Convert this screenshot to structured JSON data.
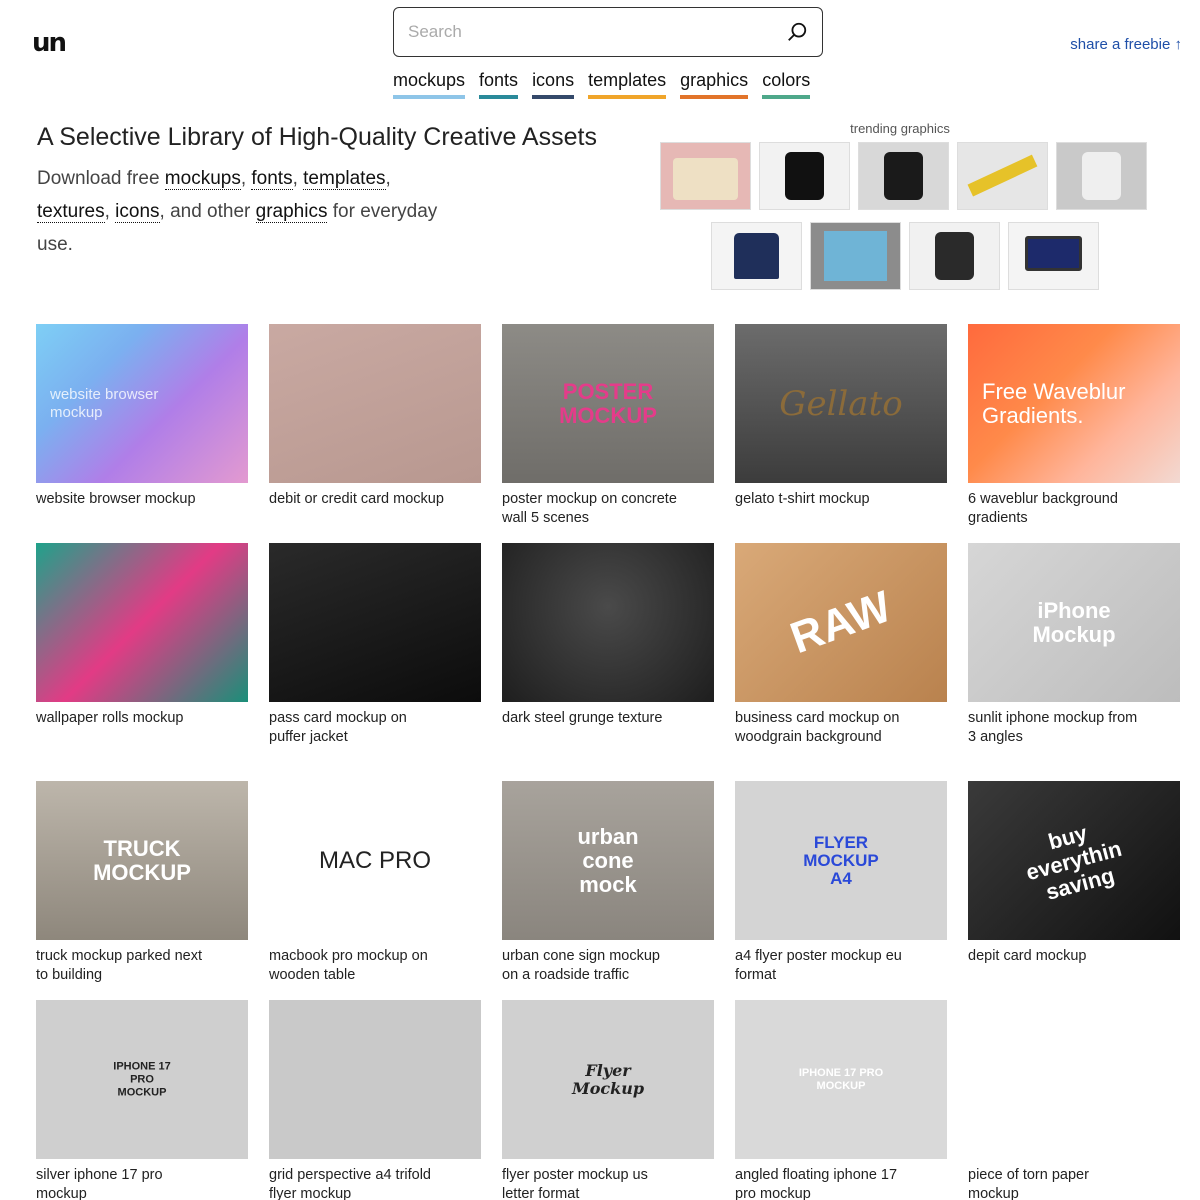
{
  "logo": "un",
  "search": {
    "placeholder": "Search"
  },
  "share": "share a freebie ↑",
  "nav": [
    {
      "label": "mockups",
      "color": "#8ec5e8"
    },
    {
      "label": "fonts",
      "color": "#2a8a9a"
    },
    {
      "label": "icons",
      "color": "#34496a"
    },
    {
      "label": "templates",
      "color": "#f0a52a"
    },
    {
      "label": "graphics",
      "color": "#e2742a"
    },
    {
      "label": "colors",
      "color": "#4ea88a"
    }
  ],
  "hero": {
    "title": "A Selective Library of High-Quality Creative Assets",
    "intro": "Download free ",
    "links": [
      "mockups",
      "fonts",
      "templates",
      "textures",
      "icons",
      "graphics"
    ],
    "sep": ", ",
    "and_other": ", and other ",
    "outro": " for everyday use."
  },
  "trending": {
    "label": "trending graphics",
    "items": [
      {
        "name": "tshirts",
        "bg": "#e6b8b5",
        "fg": "#eee0c4"
      },
      {
        "name": "iphone-dark",
        "bg": "#f2f2f2",
        "fg": "#111"
      },
      {
        "name": "iphone-apps",
        "bg": "#d8d8d8",
        "fg": "#1a1a1a"
      },
      {
        "name": "lanyard",
        "bg": "#e6e6e6",
        "fg": "#e6c229"
      },
      {
        "name": "iphone-silver",
        "bg": "#c9c9c9",
        "fg": "#efefef"
      },
      {
        "name": "polo",
        "bg": "#f4f4f4",
        "fg": "#1f2f5a"
      },
      {
        "name": "poster",
        "bg": "#8c8c8c",
        "fg": "#6fb4d6"
      },
      {
        "name": "iphone-gold",
        "bg": "#f1f1f1",
        "fg": "#2a2a2a"
      },
      {
        "name": "macbook",
        "bg": "#f4f4f4",
        "fg": "#1d2a6b"
      }
    ]
  },
  "cards": [
    {
      "title": "website browser mockup",
      "bg": "linear-gradient(135deg,#7ecff5 0%,#7bb0f0 30%,#b07ee8 60%,#e39ad0 100%)",
      "overlay": "website browser\nmockup",
      "ovColor": "#ffffff"
    },
    {
      "title": "debit or credit card mockup",
      "bg": "linear-gradient(160deg,#c9a9a2,#b89890)",
      "overlay": "",
      "ovColor": "#fff"
    },
    {
      "title": "poster mockup on concrete wall 5 scenes",
      "bg": "linear-gradient(180deg,#8d8b86,#6f6d69)",
      "overlay": "POSTER\nMOCKUP",
      "ovColor": "#e43c8a"
    },
    {
      "title": "gelato t-shirt mockup",
      "bg": "linear-gradient(180deg,#6c6c6c,#3c3c3c)",
      "overlay": "Gellato",
      "ovColor": "#8b6b3a"
    },
    {
      "title": "6 waveblur background gradients",
      "bg": "linear-gradient(135deg,#ff6a3d 0%,#ff8a4a 40%,#ffb59b 70%,#f2d9d2 100%)",
      "overlay": "Free Waveblur\nGradients.",
      "ovColor": "#ffffff"
    },
    {
      "title": "wallpaper rolls mockup",
      "bg": "linear-gradient(135deg,#1fa28a,#e23b85 50%,#1a8f79)",
      "overlay": "",
      "ovColor": "#fff"
    },
    {
      "title": "pass card mockup on puffer jacket",
      "bg": "linear-gradient(160deg,#2a2a2a,#0c0c0c)",
      "overlay": "",
      "ovColor": "#fff"
    },
    {
      "title": "dark steel grunge texture",
      "bg": "radial-gradient(circle at 50% 40%,#4a4a4a,#1e1e1e)",
      "overlay": "",
      "ovColor": "#fff"
    },
    {
      "title": "business card mockup on woodgrain background",
      "bg": "linear-gradient(135deg,#d9a978,#b9824e)",
      "overlay": "RAW",
      "ovColor": "#ffffff"
    },
    {
      "title": "sunlit iphone mockup from 3 angles",
      "bg": "linear-gradient(135deg,#d6d6d6,#bdbdbd)",
      "overlay": "iPhone\nMockup",
      "ovColor": "#ffffff"
    },
    {
      "title": "truck mockup parked next to building",
      "bg": "linear-gradient(180deg,#bdb6ab,#8e877c)",
      "overlay": "TRUCK\nMOCKUP",
      "ovColor": "#ffffff"
    },
    {
      "title": "macbook pro mockup on wooden table",
      "bg": "#ffffff",
      "overlay": "MAC PRO",
      "ovColor": "#222222"
    },
    {
      "title": "urban cone sign mockup on a roadside traffic",
      "bg": "linear-gradient(180deg,#a8a39c,#8a857e)",
      "overlay": "urban\ncone\nmock",
      "ovColor": "#ffffff"
    },
    {
      "title": "a4 flyer poster mockup eu format",
      "bg": "#d4d4d4",
      "overlay": "FLYER\nMOCKUP\nA4",
      "ovColor": "#ffffff"
    },
    {
      "title": "depit card mockup",
      "bg": "linear-gradient(135deg,#3a3a3a,#111)",
      "overlay": "buy\neverythin\nsaving",
      "ovColor": "#ffffff"
    },
    {
      "title": "silver iphone 17 pro mockup",
      "bg": "#cfcfcf",
      "overlay": "IPHONE 17\nPRO\nMOCKUP",
      "ovColor": "#222222"
    },
    {
      "title": "grid perspective a4 trifold flyer mockup",
      "bg": "#c9c9c9",
      "overlay": "",
      "ovColor": "#222"
    },
    {
      "title": "flyer poster mockup us letter format",
      "bg": "#d0d0d0",
      "overlay": "Flyer\nMockup",
      "ovColor": "#222222"
    },
    {
      "title": "angled floating iphone 17 pro mockup",
      "bg": "#d9d9d9",
      "overlay": "IPHONE 17 PRO\nMOCKUP",
      "ovColor": "#ffffff"
    },
    {
      "title": "piece of torn paper mockup",
      "bg": "#ffffff",
      "overlay": "",
      "ovColor": "#222"
    }
  ]
}
